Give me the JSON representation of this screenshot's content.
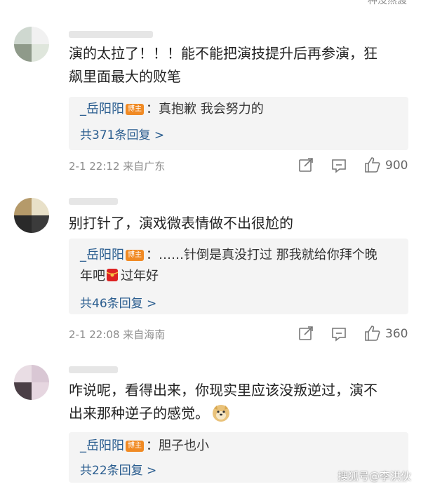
{
  "top_partial": "一种没熬渡",
  "comments": [
    {
      "text_line1": "演的太拉了！！！能不能把演技提升后再参演，狂",
      "text_line2": "飙里面最大的败笔",
      "reply_author": "_岳阳阳",
      "badge": "博主",
      "reply_text": "：真抱歉 我会努力的",
      "reply_text2": "",
      "reply_tail": "",
      "more": "共371条回复 >",
      "time": "2-1 22:12 来自广东",
      "likes": "900"
    },
    {
      "text_line1": "别打针了，演戏微表情做不出很尬的",
      "text_line2": "",
      "reply_author": "_岳阳阳",
      "badge": "博主",
      "reply_text": "：……针倒是真没打过 那我就给你拜个晚",
      "reply_text2": "年吧",
      "reply_tail": "过年好",
      "more": "共46条回复 >",
      "time": "2-1 22:08 来自海南",
      "likes": "360"
    },
    {
      "text_line1": "咋说呢，看得出来，你现实里应该没叛逆过，演不",
      "text_line2": "出来那种逆子的感觉。",
      "reply_author": "_岳阳阳",
      "badge": "博主",
      "reply_text": "：胆子也小",
      "reply_text2": "",
      "reply_tail": "",
      "more": "共22条回复 >",
      "time": "",
      "likes": ""
    }
  ],
  "watermark": "搜狐号@李洪伙",
  "icons": [
    "share-icon",
    "comment-icon",
    "thumb-up-icon",
    "red-envelope-icon",
    "doge-emoji-icon"
  ]
}
